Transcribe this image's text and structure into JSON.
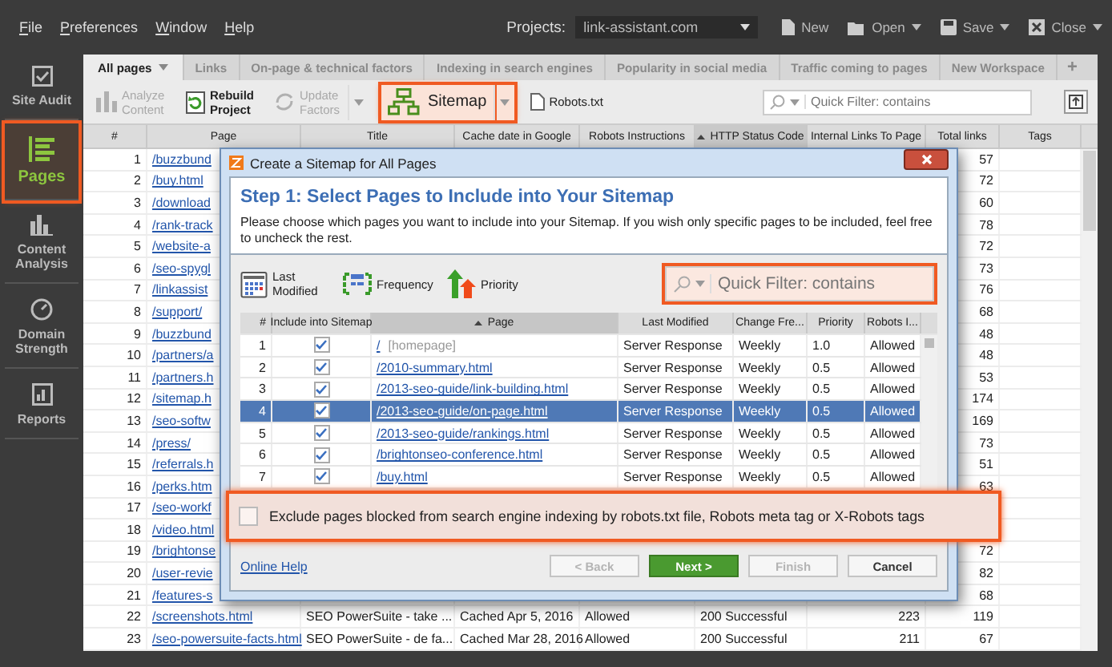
{
  "menu": [
    {
      "label": "File"
    },
    {
      "label": "Preferences"
    },
    {
      "label": "Window"
    },
    {
      "label": "Help"
    }
  ],
  "project": {
    "label": "Projects:",
    "value": "link-assistant.com"
  },
  "actions": [
    {
      "kind": "new",
      "label": "New",
      "dropdown": false
    },
    {
      "kind": "open",
      "label": "Open",
      "dropdown": true
    },
    {
      "kind": "save",
      "label": "Save",
      "dropdown": true
    },
    {
      "kind": "close",
      "label": "Close",
      "dropdown": true
    }
  ],
  "sidebar": {
    "items": [
      {
        "kind": "audit",
        "label": "Site Audit",
        "selected": false,
        "highlighted": false
      },
      {
        "kind": "pages",
        "label": "Pages",
        "selected": true,
        "highlighted": true
      },
      {
        "kind": "content",
        "label": "Content Analysis",
        "selected": false,
        "highlighted": false
      },
      {
        "kind": "domain",
        "label": "Domain Strength",
        "selected": false,
        "highlighted": false
      },
      {
        "kind": "reports",
        "label": "Reports",
        "selected": false,
        "highlighted": false
      }
    ]
  },
  "tabs": [
    {
      "label": "All pages",
      "selected": true
    },
    {
      "label": "Links",
      "selected": false
    },
    {
      "label": "On-page & technical factors",
      "selected": false
    },
    {
      "label": "Indexing in search engines",
      "selected": false
    },
    {
      "label": "Popularity in social media",
      "selected": false
    },
    {
      "label": "Traffic coming to pages",
      "selected": false
    },
    {
      "label": "New Workspace",
      "selected": false
    }
  ],
  "add_tab": "+",
  "toolbar": {
    "buttons": [
      {
        "kind": "analyze",
        "label": "Analyze Content",
        "disabled": true,
        "highlighted": false,
        "dropdown": false
      },
      {
        "kind": "rebuild",
        "label": "Rebuild Project",
        "disabled": false,
        "highlighted": false,
        "dropdown": false
      },
      {
        "kind": "update",
        "label": "Update Factors",
        "disabled": true,
        "highlighted": false,
        "dropdown": true
      },
      {
        "kind": "sitemap",
        "label": "Sitemap",
        "disabled": false,
        "highlighted": true,
        "dropdown": true
      },
      {
        "kind": "robots",
        "label": "Robots.txt",
        "disabled": false,
        "highlighted": false,
        "dropdown": false
      }
    ],
    "filter": {
      "placeholder": "Quick Filter: contains"
    }
  },
  "table": {
    "columns": [
      {
        "label": "#",
        "sorted": false
      },
      {
        "label": "Page",
        "sorted": false
      },
      {
        "label": "Title",
        "sorted": false
      },
      {
        "label": "Cache date in Google",
        "sorted": false
      },
      {
        "label": "Robots Instructions",
        "sorted": false
      },
      {
        "label": "HTTP Status Code",
        "sorted": true
      },
      {
        "label": "Internal Links To Page",
        "sorted": false
      },
      {
        "label": "Total links",
        "sorted": false
      },
      {
        "label": "Tags",
        "sorted": false
      }
    ],
    "rows": [
      {
        "num": "1",
        "page": "/buzzbund",
        "total": "57"
      },
      {
        "num": "2",
        "page": "/buy.html",
        "total": "72"
      },
      {
        "num": "3",
        "page": "/download",
        "total": "60"
      },
      {
        "num": "4",
        "page": "/rank-track",
        "total": "78"
      },
      {
        "num": "5",
        "page": "/website-a",
        "total": "72"
      },
      {
        "num": "6",
        "page": "/seo-spygl",
        "total": "73"
      },
      {
        "num": "7",
        "page": "/linkassist",
        "total": "76"
      },
      {
        "num": "8",
        "page": "/support/",
        "total": "68"
      },
      {
        "num": "9",
        "page": "/buzzbund",
        "total": "48"
      },
      {
        "num": "10",
        "page": "/partners/a",
        "total": "48"
      },
      {
        "num": "11",
        "page": "/partners.h",
        "total": "53"
      },
      {
        "num": "12",
        "page": "/sitemap.h",
        "total": "174"
      },
      {
        "num": "13",
        "page": "/seo-softw",
        "total": "169"
      },
      {
        "num": "14",
        "page": "/press/",
        "total": "73"
      },
      {
        "num": "15",
        "page": "/referrals.h",
        "total": "51"
      },
      {
        "num": "16",
        "page": "/perks.htm",
        "total": "63"
      },
      {
        "num": "17",
        "page": "/seo-workf"
      },
      {
        "num": "18",
        "page": "/video.html"
      },
      {
        "num": "19",
        "page": "/brightonse",
        "total": "72"
      },
      {
        "num": "20",
        "page": "/user-revie",
        "total": "82"
      },
      {
        "num": "21",
        "page": "/features-s",
        "total": "68"
      },
      {
        "num": "22",
        "page": "/screenshots.html",
        "title": "SEO PowerSuite - take ...",
        "cache": "Cached Apr 5, 2016",
        "robots": "Allowed",
        "status": "200 Successful",
        "internal": "223",
        "total": "119"
      },
      {
        "num": "23",
        "page": "/seo-powersuite-facts.html",
        "title": "SEO PowerSuite - de fa...",
        "cache": "Cached Mar 28, 2016",
        "robots": "Allowed",
        "status": "200 Successful",
        "internal": "211",
        "total": "67"
      }
    ]
  },
  "dialog": {
    "title": "Create a Sitemap for All Pages",
    "heading": "Step 1: Select Pages to Include into Your Sitemap",
    "description": "Please choose which pages you want to include into your Sitemap. If you wish only specific pages to be included, feel free to uncheck the rest.",
    "tools": [
      {
        "kind": "calendar",
        "label": "Last Modified"
      },
      {
        "kind": "frequency",
        "label": "Frequency"
      },
      {
        "kind": "priority",
        "label": "Priority"
      }
    ],
    "filter": {
      "placeholder": "Quick Filter: contains",
      "highlighted": true
    },
    "columns": [
      {
        "label": "#",
        "sorted": false
      },
      {
        "label": "Include into Sitemap",
        "sorted": false
      },
      {
        "label": "Page",
        "sorted": true
      },
      {
        "label": "Last Modified",
        "sorted": false
      },
      {
        "label": "Change Fre...",
        "sorted": false
      },
      {
        "label": "Priority",
        "sorted": false
      },
      {
        "label": "Robots I...",
        "sorted": false
      }
    ],
    "rows": [
      {
        "num": "1",
        "included": true,
        "page": "/",
        "note": "[homepage]",
        "last_modified": "Server Response",
        "frequency": "Weekly",
        "priority": "1.0",
        "robots": "Allowed",
        "selected": false
      },
      {
        "num": "2",
        "included": true,
        "page": "/2010-summary.html",
        "last_modified": "Server Response",
        "frequency": "Weekly",
        "priority": "0.5",
        "robots": "Allowed",
        "selected": false
      },
      {
        "num": "3",
        "included": true,
        "page": "/2013-seo-guide/link-building.html",
        "last_modified": "Server Response",
        "frequency": "Weekly",
        "priority": "0.5",
        "robots": "Allowed",
        "selected": false
      },
      {
        "num": "4",
        "included": true,
        "page": "/2013-seo-guide/on-page.html",
        "last_modified": "Server Response",
        "frequency": "Weekly",
        "priority": "0.5",
        "robots": "Allowed",
        "selected": true
      },
      {
        "num": "5",
        "included": true,
        "page": "/2013-seo-guide/rankings.html",
        "last_modified": "Server Response",
        "frequency": "Weekly",
        "priority": "0.5",
        "robots": "Allowed",
        "selected": false
      },
      {
        "num": "6",
        "included": true,
        "page": "/brightonseo-conference.html",
        "last_modified": "Server Response",
        "frequency": "Weekly",
        "priority": "0.5",
        "robots": "Allowed",
        "selected": false
      },
      {
        "num": "7",
        "included": true,
        "page": "/buy.html",
        "last_modified": "Server Response",
        "frequency": "Weekly",
        "priority": "0.5",
        "robots": "Allowed",
        "selected": false
      }
    ],
    "exclude": {
      "label": "Exclude pages blocked from search engine indexing by robots.txt file, Robots meta tag or X-Robots tags",
      "checked": false,
      "highlighted": true
    },
    "help_link": "Online Help",
    "buttons": [
      {
        "label": "< Back",
        "disabled": true,
        "primary": false
      },
      {
        "label": "Next >",
        "disabled": false,
        "primary": true
      },
      {
        "label": "Finish",
        "disabled": true,
        "primary": false
      },
      {
        "label": "Cancel",
        "disabled": false,
        "primary": false
      }
    ]
  }
}
